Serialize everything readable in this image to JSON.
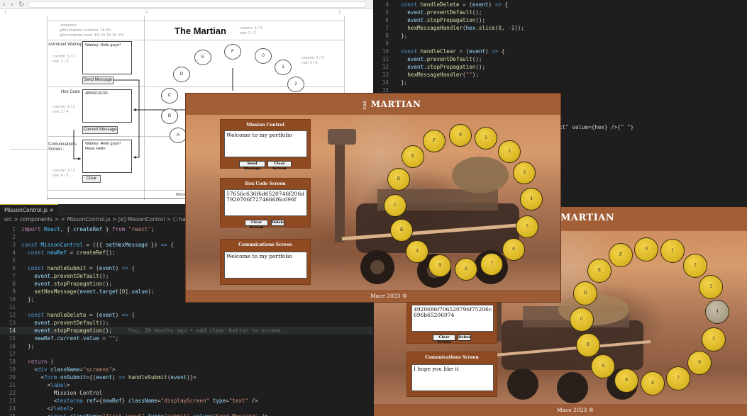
{
  "browser": {
    "back": "‹",
    "forward": "›",
    "reload": "↻"
  },
  "wireframe": {
    "title": "The Martian",
    "container_note": ".container\ngrid-template-columns: 1fr 2fr;\ngrid-template-rows: 4% 1fr 1fr 1fr 2%;",
    "title_cell_note": "column: 1 / 3\nrow: 1 / 2",
    "wheel_cell_note": "column: 2 / 3\nrow: 2 / 5",
    "footer_text": "Mace",
    "ruler": [
      "1",
      "2",
      "3"
    ],
    "sections": [
      {
        "label": "Astronaut Watney:",
        "note": "column: 1 / 2\nrow: 2 / 3",
        "box_text": "Watney: Hello guys!!",
        "button": "Send Message"
      },
      {
        "label": "Hex Code :",
        "note": "column: 1 / 2\nrow: 3 / 4",
        "box_text": "48656C6C6F",
        "button": "Convert Message"
      },
      {
        "label": "Comunications\nScreen :",
        "note": "column: 1 / 2\nrow: 4 / 5",
        "box_text": "Watney: Hello guys!!\nNasa: Hello",
        "button": "Clear"
      }
    ],
    "circles": [
      "A",
      "B",
      "C",
      "D",
      "E",
      "F",
      "0",
      "1",
      "2"
    ]
  },
  "editor_top": {
    "lines": [
      {
        "n": "4",
        "parts": [
          [
            "p",
            "  "
          ],
          [
            "b",
            "const "
          ],
          [
            "f",
            "handleDelete"
          ],
          [
            "p",
            " = ("
          ],
          [
            "v",
            "event"
          ],
          [
            "p",
            ") "
          ],
          [
            "b",
            "=>"
          ],
          [
            "p",
            " {"
          ]
        ]
      },
      {
        "n": "5",
        "parts": [
          [
            "p",
            "    "
          ],
          [
            "v",
            "event"
          ],
          [
            "p",
            "."
          ],
          [
            "f",
            "preventDefault"
          ],
          [
            "p",
            "();"
          ]
        ]
      },
      {
        "n": "6",
        "parts": [
          [
            "p",
            "    "
          ],
          [
            "v",
            "event"
          ],
          [
            "p",
            "."
          ],
          [
            "f",
            "stopPropagation"
          ],
          [
            "p",
            "();"
          ]
        ]
      },
      {
        "n": "7",
        "parts": [
          [
            "p",
            "    "
          ],
          [
            "f",
            "hexMessageHandler"
          ],
          [
            "p",
            "("
          ],
          [
            "v",
            "hex"
          ],
          [
            "p",
            "."
          ],
          [
            "f",
            "slice"
          ],
          [
            "p",
            "("
          ],
          [
            "n",
            "0"
          ],
          [
            "p",
            ", "
          ],
          [
            "n",
            "-1"
          ],
          [
            "p",
            "));"
          ]
        ]
      },
      {
        "n": "8",
        "parts": [
          [
            "p",
            "  };"
          ]
        ]
      },
      {
        "n": "9",
        "parts": [
          [
            "p",
            ""
          ]
        ]
      },
      {
        "n": "10",
        "parts": [
          [
            "p",
            "  "
          ],
          [
            "b",
            "const "
          ],
          [
            "f",
            "handleClear"
          ],
          [
            "p",
            " = ("
          ],
          [
            "v",
            "event"
          ],
          [
            "p",
            ") "
          ],
          [
            "b",
            "=>"
          ],
          [
            "p",
            " {"
          ]
        ]
      },
      {
        "n": "11",
        "parts": [
          [
            "p",
            "    "
          ],
          [
            "v",
            "event"
          ],
          [
            "p",
            "."
          ],
          [
            "f",
            "preventDefault"
          ],
          [
            "p",
            "();"
          ]
        ]
      },
      {
        "n": "12",
        "parts": [
          [
            "p",
            "    "
          ],
          [
            "v",
            "event"
          ],
          [
            "p",
            "."
          ],
          [
            "f",
            "stopPropagation"
          ],
          [
            "p",
            "();"
          ]
        ]
      },
      {
        "n": "13",
        "parts": [
          [
            "p",
            "    "
          ],
          [
            "f",
            "hexMessageHandler"
          ],
          [
            "p",
            "("
          ],
          [
            "s",
            "\"\""
          ],
          [
            "p",
            ");"
          ]
        ]
      },
      {
        "n": "14",
        "parts": [
          [
            "p",
            "  };"
          ]
        ]
      },
      {
        "n": "15",
        "parts": [
          [
            "p",
            ""
          ]
        ]
      }
    ],
    "fragment": "xt\" value={hex} />{\" \"}"
  },
  "editor_bottom": {
    "tab": "MissonControl.js",
    "breadcrumb": "src > components > ⚛ MissonControl.js > [e] MissonControl > ⬡ han",
    "current_line": "14",
    "blame": "You, 20 months ago • add clear button to screen",
    "lines": [
      {
        "n": "1",
        "parts": [
          [
            "k",
            "import "
          ],
          [
            "c",
            "React"
          ],
          [
            "p",
            ", { "
          ],
          [
            "v",
            "createRef"
          ],
          [
            "p",
            " } "
          ],
          [
            "k",
            "from "
          ],
          [
            "s",
            "\"react\""
          ],
          [
            "p",
            ";"
          ]
        ]
      },
      {
        "n": "2",
        "parts": [
          [
            "p",
            ""
          ]
        ]
      },
      {
        "n": "3",
        "parts": [
          [
            "b",
            "const "
          ],
          [
            "c",
            "MissonControl"
          ],
          [
            "p",
            " = (({ "
          ],
          [
            "v",
            "setHexMessage"
          ],
          [
            "p",
            " }) "
          ],
          [
            "b",
            "=>"
          ],
          [
            "p",
            " {"
          ]
        ]
      },
      {
        "n": "4",
        "parts": [
          [
            "p",
            "  "
          ],
          [
            "b",
            "const "
          ],
          [
            "c",
            "newRef"
          ],
          [
            "p",
            " = "
          ],
          [
            "f",
            "createRef"
          ],
          [
            "p",
            "();"
          ]
        ]
      },
      {
        "n": "5",
        "parts": [
          [
            "p",
            ""
          ]
        ]
      },
      {
        "n": "6",
        "parts": [
          [
            "p",
            "  "
          ],
          [
            "b",
            "const "
          ],
          [
            "f",
            "handleSubmit"
          ],
          [
            "p",
            " = ("
          ],
          [
            "v",
            "event"
          ],
          [
            "p",
            ") "
          ],
          [
            "b",
            "=>"
          ],
          [
            "p",
            " {"
          ]
        ]
      },
      {
        "n": "7",
        "parts": [
          [
            "p",
            "    "
          ],
          [
            "v",
            "event"
          ],
          [
            "p",
            "."
          ],
          [
            "f",
            "preventDefault"
          ],
          [
            "p",
            "();"
          ]
        ]
      },
      {
        "n": "8",
        "parts": [
          [
            "p",
            "    "
          ],
          [
            "v",
            "event"
          ],
          [
            "p",
            "."
          ],
          [
            "f",
            "stopPropagation"
          ],
          [
            "p",
            "();"
          ]
        ]
      },
      {
        "n": "9",
        "parts": [
          [
            "p",
            "    "
          ],
          [
            "f",
            "setHexMessage"
          ],
          [
            "p",
            "("
          ],
          [
            "v",
            "event"
          ],
          [
            "p",
            "."
          ],
          [
            "v",
            "target"
          ],
          [
            "p",
            "["
          ],
          [
            "n",
            "0"
          ],
          [
            "p",
            "]."
          ],
          [
            "v",
            "value"
          ],
          [
            "p",
            ");"
          ]
        ]
      },
      {
        "n": "10",
        "parts": [
          [
            "p",
            "  };"
          ]
        ]
      },
      {
        "n": "11",
        "parts": [
          [
            "p",
            ""
          ]
        ]
      },
      {
        "n": "12",
        "parts": [
          [
            "p",
            "  "
          ],
          [
            "b",
            "const "
          ],
          [
            "f",
            "handleDelete"
          ],
          [
            "p",
            " = ("
          ],
          [
            "v",
            "event"
          ],
          [
            "p",
            ") "
          ],
          [
            "b",
            "=>"
          ],
          [
            "p",
            " {"
          ]
        ]
      },
      {
        "n": "13",
        "parts": [
          [
            "p",
            "    "
          ],
          [
            "v",
            "event"
          ],
          [
            "p",
            "."
          ],
          [
            "f",
            "preventDefault"
          ],
          [
            "p",
            "();"
          ]
        ]
      },
      {
        "n": "14",
        "parts": [
          [
            "p",
            "    "
          ],
          [
            "v",
            "event"
          ],
          [
            "p",
            "."
          ],
          [
            "f",
            "stopPropagation"
          ],
          [
            "p",
            "();"
          ]
        ]
      },
      {
        "n": "15",
        "parts": [
          [
            "p",
            "    "
          ],
          [
            "v",
            "newRef"
          ],
          [
            "p",
            "."
          ],
          [
            "v",
            "current"
          ],
          [
            "p",
            "."
          ],
          [
            "v",
            "value"
          ],
          [
            "p",
            " = "
          ],
          [
            "s",
            "\"\""
          ],
          [
            "p",
            ";"
          ]
        ]
      },
      {
        "n": "16",
        "parts": [
          [
            "p",
            "  };"
          ]
        ]
      },
      {
        "n": "17",
        "parts": [
          [
            "p",
            ""
          ]
        ]
      },
      {
        "n": "18",
        "parts": [
          [
            "p",
            "  "
          ],
          [
            "k",
            "return"
          ],
          [
            "p",
            " ("
          ]
        ]
      },
      {
        "n": "19",
        "parts": [
          [
            "p",
            "    <"
          ],
          [
            "tag",
            "div"
          ],
          [
            "p",
            " "
          ],
          [
            "attr",
            "className"
          ],
          [
            "p",
            "="
          ],
          [
            "s",
            "\"screens\""
          ],
          [
            "p",
            ">"
          ]
        ]
      },
      {
        "n": "20",
        "parts": [
          [
            "p",
            "      <"
          ],
          [
            "tag",
            "form"
          ],
          [
            "p",
            " "
          ],
          [
            "attr",
            "onSubmit"
          ],
          [
            "p",
            "={("
          ],
          [
            "v",
            "event"
          ],
          [
            "p",
            ") "
          ],
          [
            "b",
            "=>"
          ],
          [
            "p",
            " "
          ],
          [
            "f",
            "handleSubmit"
          ],
          [
            "p",
            "("
          ],
          [
            "v",
            "event"
          ],
          [
            "p",
            ")}>"
          ]
        ]
      },
      {
        "n": "21",
        "parts": [
          [
            "p",
            "        <"
          ],
          [
            "tag",
            "label"
          ],
          [
            "p",
            ">"
          ]
        ]
      },
      {
        "n": "22",
        "parts": [
          [
            "p",
            "          Mission Control"
          ]
        ]
      },
      {
        "n": "23",
        "parts": [
          [
            "p",
            "          <"
          ],
          [
            "tag",
            "textarea"
          ],
          [
            "p",
            " "
          ],
          [
            "attr",
            "ref"
          ],
          [
            "p",
            "={"
          ],
          [
            "v",
            "newRef"
          ],
          [
            "p",
            "} "
          ],
          [
            "attr",
            "className"
          ],
          [
            "p",
            "="
          ],
          [
            "s",
            "\"displayScreen\""
          ],
          [
            "p",
            " "
          ],
          [
            "attr",
            "type"
          ],
          [
            "p",
            "="
          ],
          [
            "s",
            "\"text\""
          ],
          [
            "p",
            " />"
          ]
        ]
      },
      {
        "n": "24",
        "parts": [
          [
            "p",
            "        </"
          ],
          [
            "tag",
            "label"
          ],
          [
            "p",
            ">"
          ]
        ]
      },
      {
        "n": "25",
        "parts": [
          [
            "p",
            "        <"
          ],
          [
            "tag",
            "input"
          ],
          [
            "p",
            " "
          ],
          [
            "attr",
            "className"
          ],
          [
            "p",
            "="
          ],
          [
            "s",
            "\"first_input\""
          ],
          [
            "p",
            " "
          ],
          [
            "attr",
            "type"
          ],
          [
            "p",
            "="
          ],
          [
            "s",
            "\"submit\""
          ],
          [
            "p",
            " "
          ],
          [
            "attr",
            "value"
          ],
          [
            "p",
            "="
          ],
          [
            "s",
            "\"Send Message\""
          ],
          [
            "p",
            " />"
          ]
        ]
      }
    ]
  },
  "app_front": {
    "logo_small": "THE",
    "logo": "MARTIAN",
    "footer": "Mace 2023 ®",
    "mission": {
      "title": "Mission Control",
      "text": "Welcome to my portfolio",
      "send": "Send Message",
      "clear": "Clear Screen"
    },
    "hex": {
      "title": "Hex Code Screen",
      "text": "57656c636f6d6520746f206d7920706f7274666f6c696f",
      "clear": "Clear Screen",
      "delete": "Delete"
    },
    "comms": {
      "title": "Comunications Screen",
      "text": "Welcome to my portfolio"
    },
    "discs": [
      "0",
      "1",
      "2",
      "3",
      "4",
      "5",
      "6",
      "7",
      "8",
      "9",
      "A",
      "B",
      "C",
      "D",
      "E",
      "F"
    ]
  },
  "app_back": {
    "logo": "MARTIAN",
    "footer": "Mace 2023 ®",
    "hex": {
      "text": "4920686f706520796f75206c696b65206974",
      "clear": "Clear Screen",
      "delete": "Delete"
    },
    "comms": {
      "title": "Comunications Screen",
      "text": "I hope you like it"
    },
    "discs": [
      "0",
      "1",
      "2",
      "3",
      "4",
      "5",
      "6",
      "7",
      "8",
      "9",
      "A",
      "B",
      "C",
      "D",
      "E",
      "F"
    ],
    "hover_disc": "4"
  }
}
